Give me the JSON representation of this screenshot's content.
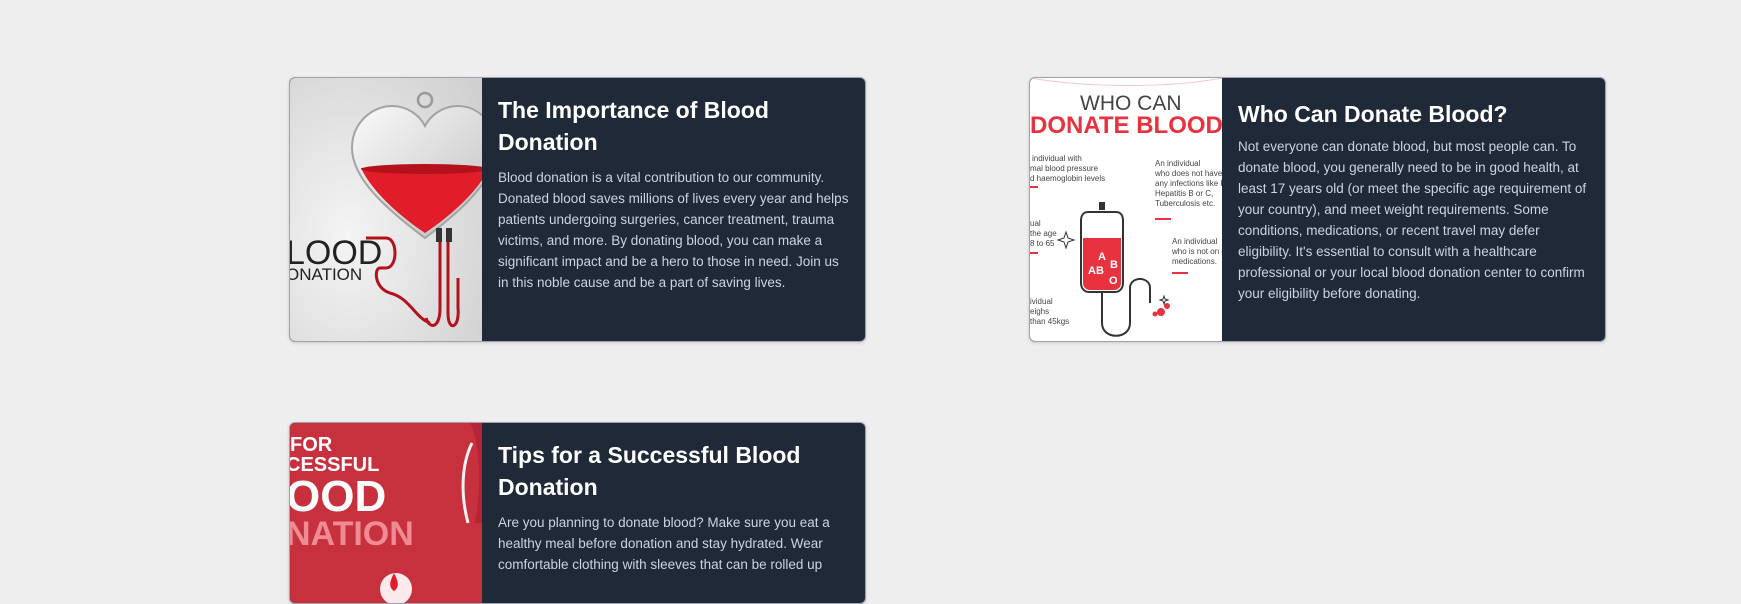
{
  "colors": {
    "page_bg": "#eeeeee",
    "card_bg": "#1f2937",
    "title": "#ffffff",
    "text": "#cbd5e1",
    "blood_red": "#e11d2a"
  },
  "cards": [
    {
      "title": "The Importance of Blood Donation",
      "text": "Blood donation is a vital contribution to our community. Donated blood saves millions of lives every year and helps patients undergoing surgeries, cancer treatment, trauma victims, and more. By donating blood, you can make a significant impact and be a hero to those in need. Join us in this noble cause and be a part of saving lives.",
      "image": {
        "icon": "heart-blood-bag-icon",
        "line1": "LOOD",
        "line2": "ONATION"
      }
    },
    {
      "title": "Who Can Donate Blood?",
      "text": "Not everyone can donate blood, but most people can. To donate blood, you generally need to be in good health, at least 17 years old (or meet the specific age requirement of your country), and meet weight requirements. Some conditions, medications, or recent travel may defer eligibility. It's essential to consult with a healthcare professional or your local blood donation center to confirm your eligibility before donating.",
      "image": {
        "icon": "blood-bag-infographic-icon",
        "heading1": "WHO CAN",
        "heading2": "DONATE BLOOD?",
        "note_left_1a": "individual with",
        "note_left_1b": "mal blood pressure",
        "note_left_1c": "d haemoglobin levels",
        "note_left_2a": "ual",
        "note_left_2b": "the age",
        "note_left_2c": "8 to 65",
        "note_left_3a": "ividual",
        "note_left_3b": "eighs",
        "note_left_3c": "than 45kgs",
        "note_right_1a": "An individual",
        "note_right_1b": "who does not have",
        "note_right_1c": "any infections like H",
        "note_right_1d": "Hepatitis B or C,",
        "note_right_1e": "Tuberculosis etc.",
        "note_right_2a": "An individual",
        "note_right_2b": "who is not on c",
        "note_right_2c": "medications.",
        "bag_label_1": "A",
        "bag_label_2": "AB",
        "bag_label_3": "B",
        "bag_label_4": "O"
      }
    },
    {
      "title": "Tips for a Successful Blood Donation",
      "text": "Are you planning to donate blood? Make sure you eat a healthy meal before donation and stay hydrated. Wear comfortable clothing with sleeves that can be rolled up",
      "image": {
        "icon": "blood-donation-poster-icon",
        "line1": "FOR",
        "line2": "CESSFUL",
        "line3": "OOD",
        "line4": "NATION"
      }
    }
  ]
}
